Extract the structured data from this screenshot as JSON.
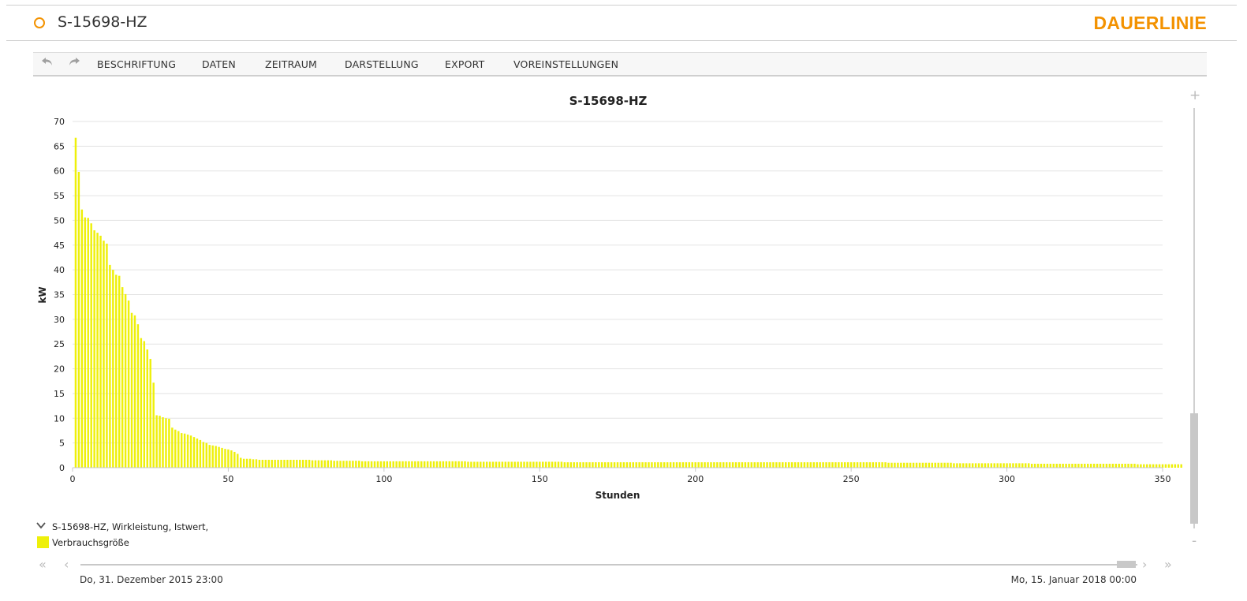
{
  "header": {
    "title": "S-15698-HZ",
    "app_title": "DAUERLINIE",
    "accent_color": "#f39200"
  },
  "toolbar": {
    "undo_icon": "undo-arrow-icon",
    "redo_icon": "redo-arrow-icon",
    "items": [
      {
        "label": "BESCHRIFTUNG"
      },
      {
        "label": "DATEN"
      },
      {
        "label": "ZEITRAUM"
      },
      {
        "label": "DARSTELLUNG"
      },
      {
        "label": "EXPORT"
      },
      {
        "label": "VOREINSTELLUNGEN"
      }
    ]
  },
  "zoom": {
    "plus": "+",
    "minus": "-"
  },
  "legend": {
    "group": "S-15698-HZ, Wirkleistung, Istwert,",
    "entry": "Verbrauchsgröße",
    "swatch_color": "#eef00a"
  },
  "navigator": {
    "first": "«",
    "prev": "‹",
    "next": "›",
    "last": "»",
    "start_label": "Do, 31. Dezember 2015 23:00",
    "end_label": "Mo, 15. Januar 2018 00:00"
  },
  "chart_data": {
    "type": "bar",
    "title": "S-15698-HZ",
    "xlabel": "Stunden",
    "ylabel": "kW",
    "xlim": [
      0,
      350
    ],
    "ylim": [
      0,
      70
    ],
    "xticks": [
      0,
      50,
      100,
      150,
      200,
      250,
      300,
      350
    ],
    "yticks": [
      0,
      5,
      10,
      15,
      20,
      25,
      30,
      35,
      40,
      45,
      50,
      55,
      60,
      65,
      70
    ],
    "grid": true,
    "bar_color": "#eef00a",
    "series": [
      {
        "name": "Verbrauchsgröße",
        "x_start": 1,
        "x_step": 1,
        "values": [
          66.7,
          59.8,
          52.2,
          50.6,
          50.5,
          49.4,
          48.0,
          47.5,
          46.9,
          45.9,
          45.3,
          41.0,
          40.0,
          39.0,
          38.8,
          36.5,
          35.1,
          33.8,
          31.3,
          30.8,
          29.0,
          26.2,
          25.6,
          23.9,
          22.0,
          17.2,
          10.6,
          10.5,
          10.2,
          10.0,
          9.9,
          8.1,
          7.7,
          7.4,
          7.0,
          6.9,
          6.7,
          6.5,
          6.2,
          5.9,
          5.6,
          5.2,
          5.0,
          4.6,
          4.5,
          4.4,
          4.2,
          4.0,
          3.8,
          3.7,
          3.5,
          3.2,
          2.8,
          2.0,
          1.8,
          1.8,
          1.8,
          1.7,
          1.7,
          1.6,
          1.6,
          1.6,
          1.6,
          1.6,
          1.6,
          1.6,
          1.6,
          1.6,
          1.6,
          1.6,
          1.6,
          1.6,
          1.6,
          1.6,
          1.6,
          1.6,
          1.5,
          1.5,
          1.5,
          1.5,
          1.5,
          1.5,
          1.5,
          1.4,
          1.4,
          1.4,
          1.4,
          1.4,
          1.4,
          1.4,
          1.4,
          1.4,
          1.3,
          1.3,
          1.3,
          1.3,
          1.3,
          1.3,
          1.3,
          1.3,
          1.3,
          1.3,
          1.3,
          1.3,
          1.3,
          1.3,
          1.3,
          1.3,
          1.3,
          1.3,
          1.3,
          1.3,
          1.3,
          1.3,
          1.3,
          1.3,
          1.3,
          1.3,
          1.3,
          1.3,
          1.3,
          1.3,
          1.3,
          1.3,
          1.3,
          1.3,
          1.2,
          1.2,
          1.2,
          1.2,
          1.2,
          1.2,
          1.2,
          1.2,
          1.2,
          1.2,
          1.2,
          1.2,
          1.2,
          1.2,
          1.2,
          1.2,
          1.2,
          1.2,
          1.2,
          1.2,
          1.2,
          1.2,
          1.2,
          1.2,
          1.2,
          1.2,
          1.2,
          1.2,
          1.2,
          1.2,
          1.2,
          1.1,
          1.1,
          1.1,
          1.1,
          1.1,
          1.1,
          1.1,
          1.1,
          1.1,
          1.1,
          1.1,
          1.1,
          1.1,
          1.1,
          1.1,
          1.1,
          1.1,
          1.1,
          1.1,
          1.1,
          1.1,
          1.1,
          1.1,
          1.1,
          1.1,
          1.1,
          1.1,
          1.1,
          1.1,
          1.1,
          1.1,
          1.1,
          1.1,
          1.1,
          1.1,
          1.1,
          1.1,
          1.1,
          1.1,
          1.1,
          1.1,
          1.1,
          1.1,
          1.1,
          1.1,
          1.1,
          1.1,
          1.1,
          1.1,
          1.1,
          1.1,
          1.1,
          1.1,
          1.1,
          1.1,
          1.1,
          1.1,
          1.1,
          1.1,
          1.1,
          1.1,
          1.1,
          1.1,
          1.1,
          1.1,
          1.1,
          1.1,
          1.1,
          1.1,
          1.1,
          1.1,
          1.1,
          1.1,
          1.1,
          1.1,
          1.1,
          1.1,
          1.1,
          1.1,
          1.1,
          1.1,
          1.1,
          1.1,
          1.1,
          1.1,
          1.1,
          1.1,
          1.1,
          1.1,
          1.1,
          1.1,
          1.1,
          1.1,
          1.1,
          1.1,
          1.1,
          1.1,
          1.1,
          1.1,
          1.1,
          1.1,
          1.1,
          1.1,
          1.1,
          1.0,
          1.0,
          1.0,
          1.0,
          1.0,
          1.0,
          1.0,
          1.0,
          1.0,
          1.0,
          1.0,
          1.0,
          1.0,
          1.0,
          1.0,
          1.0,
          1.0,
          1.0,
          1.0,
          1.0,
          1.0,
          0.9,
          0.9,
          0.9,
          0.9,
          0.9,
          0.9,
          0.9,
          0.9,
          0.9,
          0.9,
          0.9,
          0.9,
          0.9,
          0.9,
          0.9,
          0.9,
          0.9,
          0.9,
          0.9,
          0.9,
          0.9,
          0.9,
          0.9,
          0.9,
          0.9,
          0.8,
          0.8,
          0.8,
          0.8,
          0.8,
          0.8,
          0.8,
          0.8,
          0.8,
          0.8,
          0.8,
          0.8,
          0.8,
          0.8,
          0.8,
          0.8,
          0.8,
          0.8,
          0.8,
          0.8,
          0.8,
          0.8,
          0.8,
          0.8,
          0.8,
          0.8,
          0.8,
          0.8,
          0.8,
          0.8,
          0.8,
          0.8,
          0.8,
          0.8,
          0.7,
          0.7,
          0.7,
          0.7,
          0.7,
          0.7,
          0.7,
          0.7,
          0.7,
          0.7,
          0.7,
          0.7,
          0.7,
          0.7,
          0.7,
          0.7,
          0.7,
          0.7,
          0.7,
          0.7,
          0.6,
          0.6
        ]
      }
    ]
  }
}
